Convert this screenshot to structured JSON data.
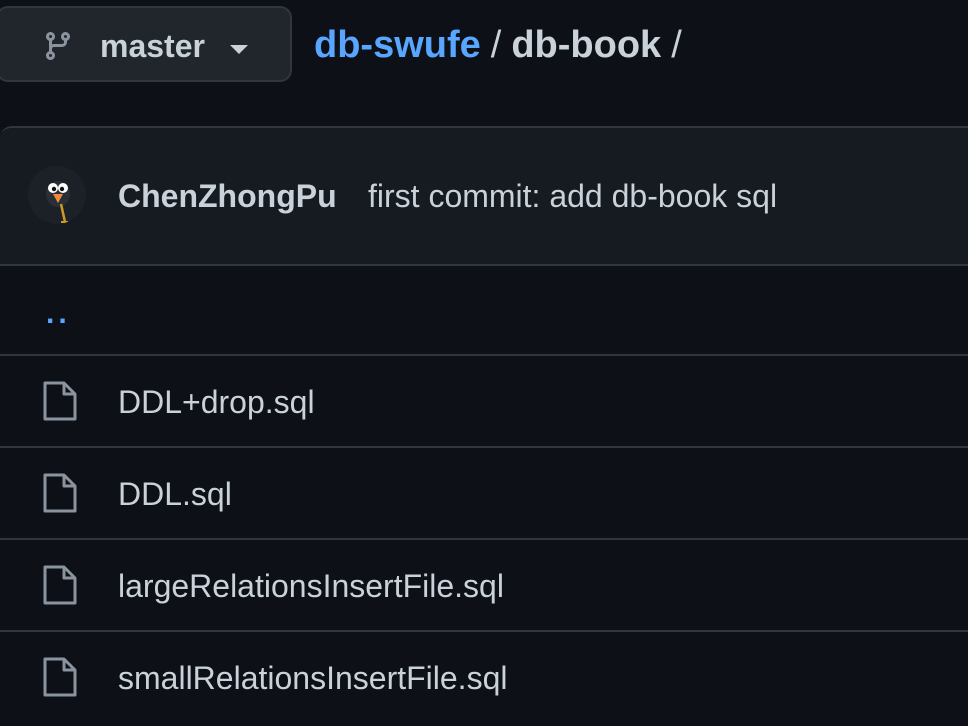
{
  "branch": {
    "name": "master",
    "icon": "git-branch-icon",
    "caret_icon": "triangle-down-icon"
  },
  "breadcrumb": {
    "repo": "db-swufe",
    "separator": "/",
    "directory": "db-book",
    "trailing_separator": "/"
  },
  "commit": {
    "author": "ChenZhongPu",
    "message": "first commit: add db-book sql",
    "avatar_icon": "bird-avatar"
  },
  "parent_dir": {
    "label": ".."
  },
  "files": [
    {
      "name": "DDL+drop.sql",
      "icon": "file-icon"
    },
    {
      "name": "DDL.sql",
      "icon": "file-icon"
    },
    {
      "name": "largeRelationsInsertFile.sql",
      "icon": "file-icon"
    },
    {
      "name": "smallRelationsInsertFile.sql",
      "icon": "file-icon"
    }
  ],
  "colors": {
    "background": "#0d1117",
    "link": "#58a6ff",
    "text": "#c9d1d9",
    "border": "#30363d",
    "header_bg": "#161b22"
  }
}
